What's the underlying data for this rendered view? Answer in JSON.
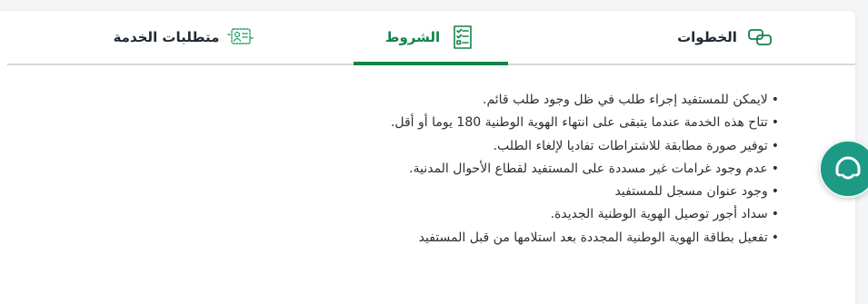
{
  "tabs": [
    {
      "label": "الخطوات",
      "icon": "steps-link-icon",
      "active": false
    },
    {
      "label": "الشروط",
      "icon": "checklist-icon",
      "active": true
    },
    {
      "label": "متطلبات الخدمة",
      "icon": "id-card-requirements-icon",
      "active": false
    }
  ],
  "terms": [
    "لايمكن للمستفيد إجراء طلب في ظل وجود طلب قائم.",
    "تتاح هذه الخدمة عندما يتبقى على انتهاء الهوية الوطنية 180 يوما أو أقل.",
    "توفير صورة مطابقة للاشتراطات تفاديا لإلغاء الطلب.",
    "عدم وجود غرامات غير مسددة على المستفيد لقطاع الأحوال المدنية.",
    "وجود عنوان مسجل للمستفيد",
    "سداد أجور توصيل الهوية الوطنية الجديدة.",
    "تفعيل بطاقة الهوية الوطنية المجددة بعد استلامها من قبل المستفيد"
  ],
  "bullet": "•",
  "chat_widget": {
    "icon": "chat-support-icon"
  },
  "colors": {
    "accent": "#13834a",
    "chat": "#1c9a86",
    "divider": "#d6d8da",
    "text": "#2b2f33"
  }
}
